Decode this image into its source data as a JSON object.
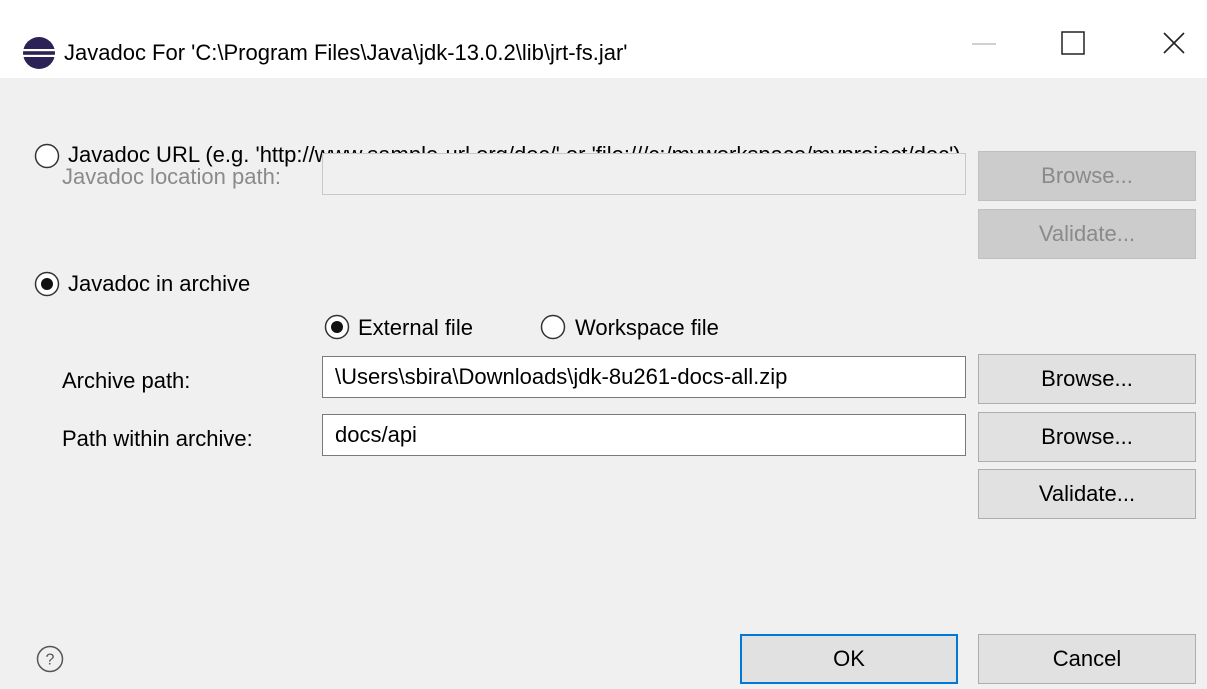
{
  "window": {
    "title": "Javadoc For 'C:\\Program Files\\Java\\jdk-13.0.2\\lib\\jrt-fs.jar'",
    "app_icon": "eclipse-icon",
    "controls": [
      "minimize-icon",
      "maximize-icon",
      "close-icon"
    ]
  },
  "url_option": {
    "label": "Javadoc URL (e.g. 'http://www.sample-url.org/doc/' or 'file:///c:/myworkspace/myproject/doc')",
    "selected": false,
    "location_label": "Javadoc location path:",
    "location_value": "",
    "browse_label": "Browse...",
    "validate_label": "Validate..."
  },
  "archive_option": {
    "label": "Javadoc in archive",
    "selected": true,
    "external_file_label": "External file",
    "external_selected": true,
    "workspace_file_label": "Workspace file",
    "workspace_selected": false,
    "archive_path_label": "Archive path:",
    "archive_path_value": "\\Users\\sbira\\Downloads\\jdk-8u261-docs-all.zip",
    "archive_browse_label": "Browse...",
    "within_label": "Path within archive:",
    "within_value": "docs/api",
    "within_browse_label": "Browse...",
    "validate_label": "Validate..."
  },
  "footer": {
    "help_icon": "help-icon",
    "ok_label": "OK",
    "cancel_label": "Cancel"
  },
  "colors": {
    "dialog_bg": "#f0f0f0",
    "default_button_border": "#0078d7",
    "disabled_text": "#8a8a8a"
  }
}
